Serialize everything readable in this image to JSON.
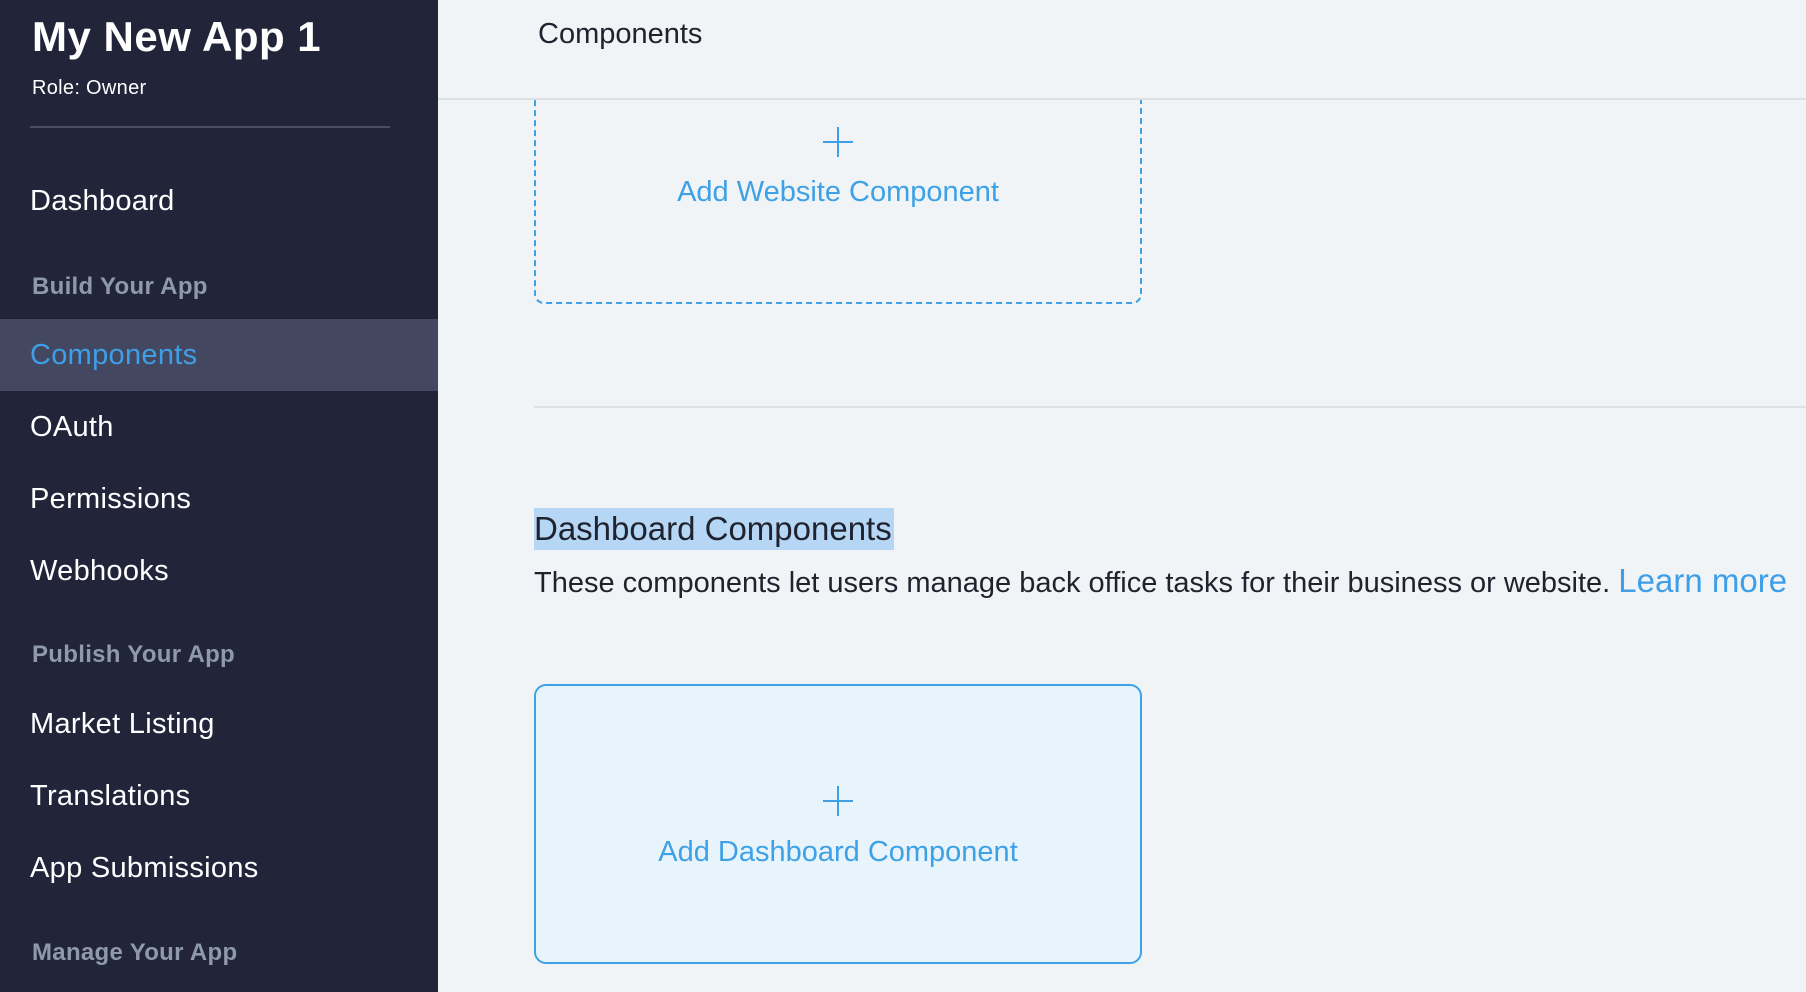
{
  "sidebar": {
    "app_title": "My New App 1",
    "role": "Role: Owner",
    "items": [
      {
        "label": "Dashboard"
      },
      {
        "label": "Build Your App"
      },
      {
        "label": "Components"
      },
      {
        "label": "OAuth"
      },
      {
        "label": "Permissions"
      },
      {
        "label": "Webhooks"
      },
      {
        "label": "Publish Your App"
      },
      {
        "label": "Market Listing"
      },
      {
        "label": "Translations"
      },
      {
        "label": "App Submissions"
      },
      {
        "label": "Manage Your App"
      }
    ],
    "active_item": "Components"
  },
  "header": {
    "title": "Components"
  },
  "website_section": {
    "add_label": "Add Website Component",
    "icon": "plus-icon"
  },
  "dashboard_section": {
    "title": "Dashboard Components",
    "description": "These components let users manage back office tasks for their business or website.",
    "learn_more": "Learn more",
    "add_label": "Add Dashboard Component",
    "icon": "plus-icon"
  },
  "colors": {
    "sidebar_bg": "#22253A",
    "active_bg": "#43475F",
    "accent": "#3E9FE8",
    "section_label": "#8E9AAB",
    "main_bg": "#F0F4F7",
    "highlight": "#B5D6F5"
  }
}
